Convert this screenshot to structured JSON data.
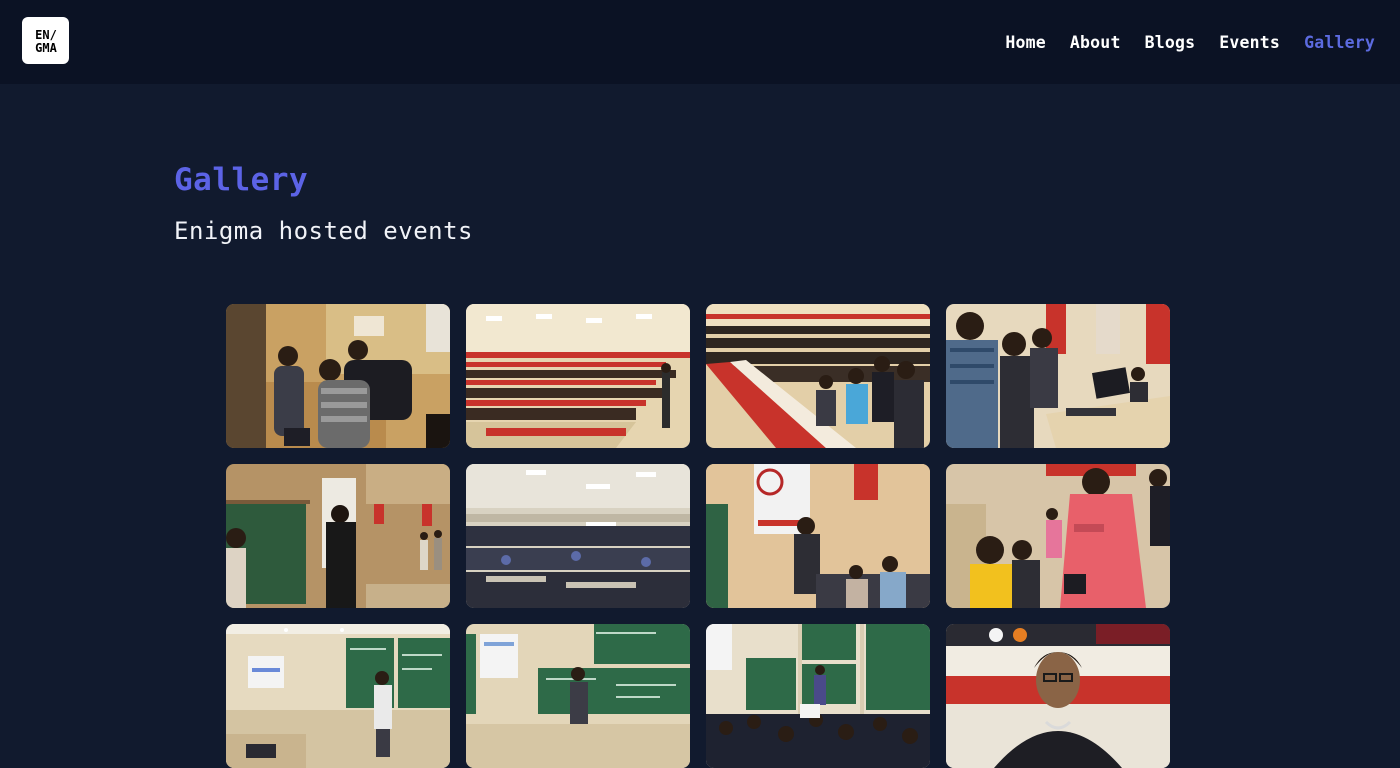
{
  "brand": {
    "logo_line1": "EN/",
    "logo_line2": "GMA"
  },
  "nav": {
    "items": [
      {
        "label": "Home",
        "active": false
      },
      {
        "label": "About",
        "active": false
      },
      {
        "label": "Blogs",
        "active": false
      },
      {
        "label": "Events",
        "active": false
      },
      {
        "label": "Gallery",
        "active": true
      }
    ]
  },
  "gallery": {
    "title": "Gallery",
    "subtitle": "Enigma hosted events",
    "photos": [
      {
        "scene": "workshop-group"
      },
      {
        "scene": "auditorium-wide"
      },
      {
        "scene": "auditorium-side"
      },
      {
        "scene": "students-laptops"
      },
      {
        "scene": "speaker-dark-room"
      },
      {
        "scene": "auditorium-crowd"
      },
      {
        "scene": "rust-presentation"
      },
      {
        "scene": "student-help"
      },
      {
        "scene": "lecture-speaker"
      },
      {
        "scene": "chalkboard-speaker"
      },
      {
        "scene": "lecture-hall-crowd"
      },
      {
        "scene": "student-portrait"
      }
    ]
  },
  "colors": {
    "background": "#111A2E",
    "navbar": "#0B1224",
    "accent": "#5C63E6",
    "text": "#FFFFFF"
  }
}
